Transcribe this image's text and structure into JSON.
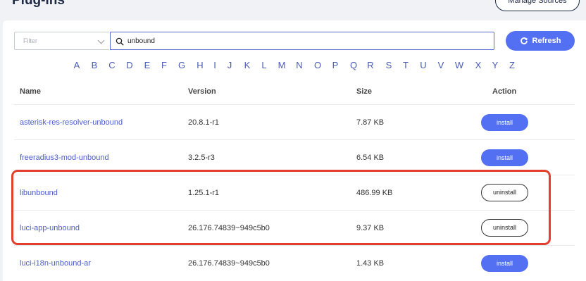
{
  "page": {
    "title": "Plug-ins",
    "manage_sources_label": "Manage Sources"
  },
  "toolbar": {
    "filter_placeholder": "Filter",
    "search_value": "unbound",
    "refresh_label": "Refresh"
  },
  "alphabet": [
    "A",
    "B",
    "C",
    "D",
    "E",
    "F",
    "G",
    "H",
    "I",
    "J",
    "K",
    "L",
    "M",
    "N",
    "O",
    "P",
    "Q",
    "R",
    "S",
    "T",
    "U",
    "V",
    "W",
    "X",
    "Y",
    "Z"
  ],
  "table": {
    "headers": {
      "name": "Name",
      "version": "Version",
      "size": "Size",
      "action": "Action"
    },
    "rows": [
      {
        "name": "asterisk-res-resolver-unbound",
        "version": "20.8.1-r1",
        "size": "7.87 KB",
        "action": "install"
      },
      {
        "name": "freeradius3-mod-unbound",
        "version": "3.2.5-r3",
        "size": "6.54 KB",
        "action": "install"
      },
      {
        "name": "libunbound",
        "version": "1.25.1-r1",
        "size": "486.99 KB",
        "action": "uninstall"
      },
      {
        "name": "luci-app-unbound",
        "version": "26.176.74839~949c5b0",
        "size": "9.37 KB",
        "action": "uninstall"
      },
      {
        "name": "luci-i18n-unbound-ar",
        "version": "26.176.74839~949c5b0",
        "size": "1.43 KB",
        "action": "install"
      }
    ]
  },
  "colors": {
    "accent": "#5470f2",
    "highlight": "#e23f2e",
    "link": "#4a5bd0"
  }
}
